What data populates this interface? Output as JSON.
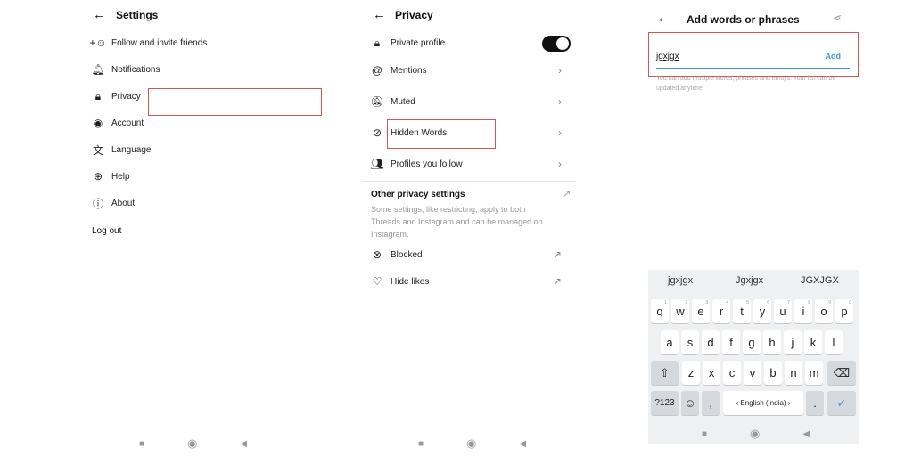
{
  "settings": {
    "title": "Settings",
    "items": [
      {
        "icon": "add-person-icon",
        "label": "Follow and invite friends"
      },
      {
        "icon": "bell-icon",
        "label": "Notifications"
      },
      {
        "icon": "lock-icon",
        "label": "Privacy"
      },
      {
        "icon": "account-icon",
        "label": "Account"
      },
      {
        "icon": "language-icon",
        "label": "Language"
      },
      {
        "icon": "help-icon",
        "label": "Help"
      },
      {
        "icon": "info-icon",
        "label": "About"
      }
    ],
    "logout": "Log out"
  },
  "privacy": {
    "title": "Privacy",
    "private_profile": "Private profile",
    "private_profile_on": true,
    "items": [
      {
        "icon": "at-icon",
        "label": "Mentions"
      },
      {
        "icon": "muted-bell-icon",
        "label": "Muted"
      },
      {
        "icon": "eye-off-icon",
        "label": "Hidden Words"
      },
      {
        "icon": "people-icon",
        "label": "Profiles you follow"
      }
    ],
    "other_title": "Other privacy settings",
    "other_desc": "Some settings, like restricting, apply to both Threads and Instagram and can be managed on Instagram.",
    "external": [
      {
        "icon": "blocked-icon",
        "label": "Blocked"
      },
      {
        "icon": "heart-off-icon",
        "label": "Hide likes"
      }
    ]
  },
  "add_words": {
    "title": "Add words or phrases",
    "input_value": "jgxjgx",
    "add_label": "Add",
    "helper": "You can add multiple words, phrases and emojis. Your list can be updated anytime."
  },
  "keyboard": {
    "suggestions": [
      "jgxjgx",
      "Jgxjgx",
      "JGXJGX"
    ],
    "row1": [
      "q",
      "w",
      "e",
      "r",
      "t",
      "y",
      "u",
      "i",
      "o",
      "p"
    ],
    "row1_hints": [
      "1",
      "2",
      "3",
      "4",
      "5",
      "6",
      "7",
      "8",
      "9",
      "0"
    ],
    "row2": [
      "a",
      "s",
      "d",
      "f",
      "g",
      "h",
      "j",
      "k",
      "l"
    ],
    "row3": [
      "z",
      "x",
      "c",
      "v",
      "b",
      "n",
      "m"
    ],
    "symbols": "?123",
    "comma": ",",
    "space": "‹ English (India) ›",
    "period": "."
  },
  "colors": {
    "accent": "#3897f0",
    "highlight": "#d9534f"
  }
}
